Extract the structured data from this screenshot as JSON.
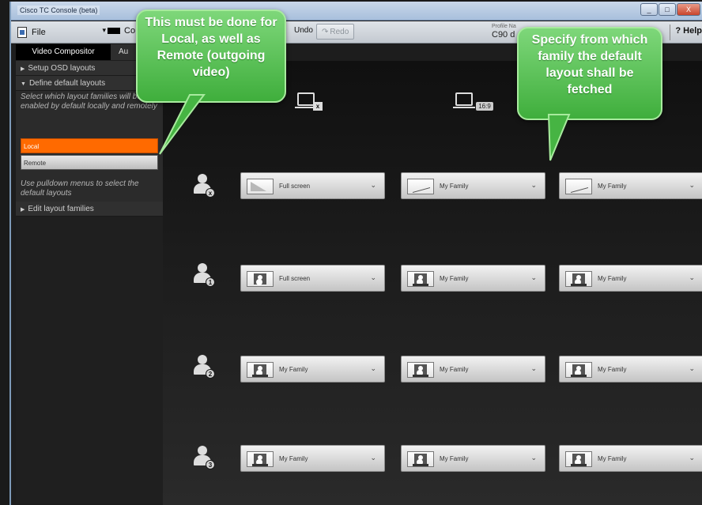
{
  "window": {
    "title": "Cisco TC Console (beta)",
    "controls": [
      "_",
      "□",
      "X"
    ]
  },
  "toolbar": {
    "file_label": "File",
    "compositor_label": "Co",
    "undo_label": "Undo",
    "redo_label": "Redo",
    "profile_label": "Profile Na",
    "profile_value": "C90 d",
    "help_label": "? Help"
  },
  "tabs": [
    {
      "label": "Video Compositor",
      "active": true
    },
    {
      "label": "Au",
      "active": false
    }
  ],
  "sidebar": {
    "setup_osd": "Setup OSD layouts",
    "define_default": "Define default layouts",
    "define_note": "Select which layout families will be enabled by default locally and remotely",
    "local_button": "Local",
    "remote_button": "Remote",
    "pulldown_note": "Use pulldown menus to select the default layouts",
    "edit_families": "Edit layout families"
  },
  "columns": [
    {
      "icon": "monitor-x-icon",
      "badge": "x"
    },
    {
      "icon": "monitor-169-icon",
      "badge": "16:9"
    }
  ],
  "rows": [
    {
      "participant": "x",
      "dropdowns": [
        {
          "thumb": "fullscreen",
          "label": "Full screen"
        },
        {
          "thumb": "chart",
          "label": "My Family"
        },
        {
          "thumb": "chart",
          "label": "My Family"
        }
      ]
    },
    {
      "participant": "1",
      "dropdowns": [
        {
          "thumb": "person",
          "label": "Full screen"
        },
        {
          "thumb": "person",
          "label": "My Family"
        },
        {
          "thumb": "person",
          "label": "My Family"
        }
      ]
    },
    {
      "participant": "2",
      "dropdowns": [
        {
          "thumb": "person",
          "label": "My Family"
        },
        {
          "thumb": "person",
          "label": "My Family"
        },
        {
          "thumb": "person",
          "label": "My Family"
        }
      ]
    },
    {
      "participant": "3",
      "dropdowns": [
        {
          "thumb": "person",
          "label": "My Family"
        },
        {
          "thumb": "person",
          "label": "My Family"
        },
        {
          "thumb": "person",
          "label": "My Family"
        }
      ]
    }
  ],
  "callouts": {
    "left": "This must be done for Local, as well as Remote (outgoing video)",
    "right": "Specify from which family the default layout shall be fetched"
  },
  "colors": {
    "local_accent": "#ff6a00",
    "callout_green": "#4fbf4a"
  }
}
